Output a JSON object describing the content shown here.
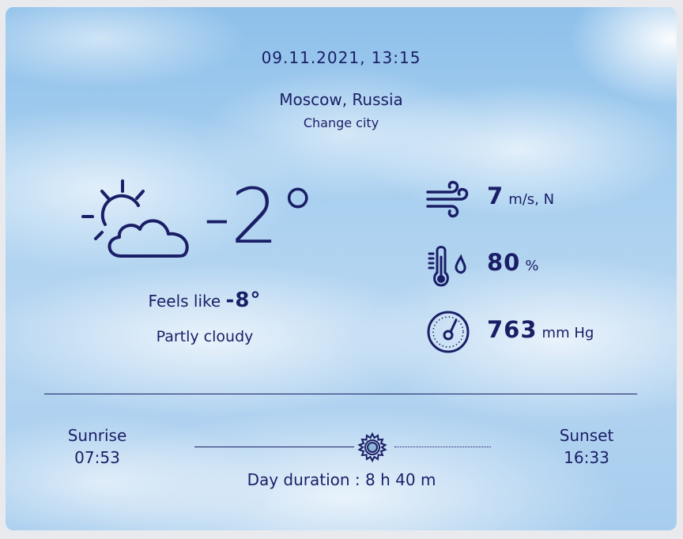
{
  "header": {
    "datetime": "09.11.2021, 13:15",
    "city": "Moscow, Russia",
    "change_city": "Change city"
  },
  "current": {
    "temperature": "-2°",
    "feels_like_label": "Feels like",
    "feels_like_value": "-8°",
    "condition": "Partly cloudy",
    "icon": "partly-cloudy-icon"
  },
  "metrics": {
    "wind": {
      "value": "7",
      "unit": "m/s, N",
      "icon": "wind-icon"
    },
    "humidity": {
      "value": "80",
      "unit": "%",
      "icon": "humidity-icon"
    },
    "pressure": {
      "value": "763",
      "unit": "mm Hg",
      "icon": "barometer-icon"
    }
  },
  "sun": {
    "sunrise_label": "Sunrise",
    "sunrise_time": "07:53",
    "sunset_label": "Sunset",
    "sunset_time": "16:33",
    "day_duration": "Day duration : 8 h 40 m",
    "icon": "sun-icon"
  },
  "colors": {
    "text": "#1a1e66",
    "sky": "#a9d0f0"
  }
}
